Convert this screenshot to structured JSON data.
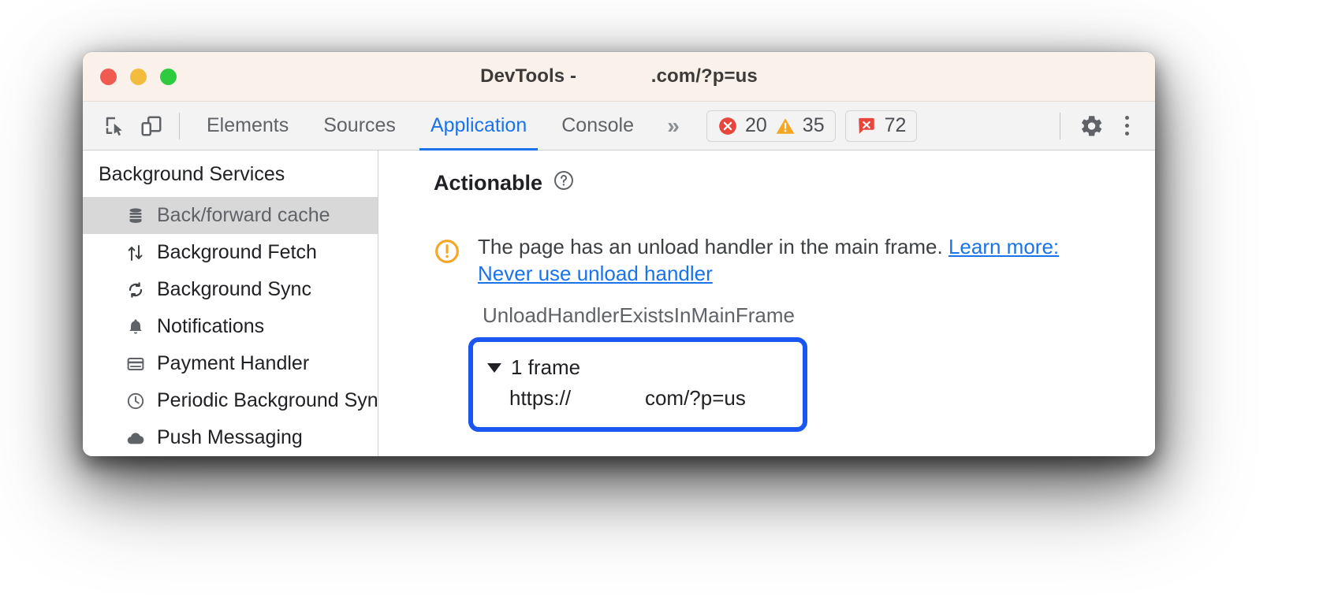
{
  "window": {
    "title": "DevTools -              .com/?p=us"
  },
  "toolbar": {
    "icons": {
      "inspect": "inspect-element-icon",
      "device": "device-toolbar-icon",
      "more": "»",
      "settings": "gear-icon",
      "menu": "kebab-menu-icon"
    },
    "tabs": [
      {
        "label": "Elements",
        "active": false
      },
      {
        "label": "Sources",
        "active": false
      },
      {
        "label": "Application",
        "active": true
      },
      {
        "label": "Console",
        "active": false
      }
    ],
    "badges": {
      "errors": "20",
      "warnings": "35",
      "issues": "72"
    }
  },
  "sidebar": {
    "section_title": "Background Services",
    "items": [
      {
        "label": "Back/forward cache",
        "icon": "database-icon",
        "selected": true
      },
      {
        "label": "Background Fetch",
        "icon": "updown-arrows-icon",
        "selected": false
      },
      {
        "label": "Background Sync",
        "icon": "sync-icon",
        "selected": false
      },
      {
        "label": "Notifications",
        "icon": "bell-icon",
        "selected": false
      },
      {
        "label": "Payment Handler",
        "icon": "credit-card-icon",
        "selected": false
      },
      {
        "label": "Periodic Background Sync",
        "icon": "clock-icon",
        "selected": false
      },
      {
        "label": "Push Messaging",
        "icon": "cloud-icon",
        "selected": false
      }
    ]
  },
  "main": {
    "panel_title": "Actionable",
    "help_icon": "help-circle-icon",
    "issue": {
      "icon": "warning-circle-icon",
      "text": "The page has an unload handler in the main frame. ",
      "link_text": "Learn more: Never use unload handler"
    },
    "reason_code": "UnloadHandlerExistsInMainFrame",
    "frames": {
      "header": "1 frame",
      "url": "https://             com/?p=us"
    }
  },
  "colors": {
    "accent": "#1a73e8",
    "highlight_box": "#1a56ef",
    "error": "#e8453c",
    "warning": "#f5a623",
    "title_bar": "#faf1ea"
  }
}
